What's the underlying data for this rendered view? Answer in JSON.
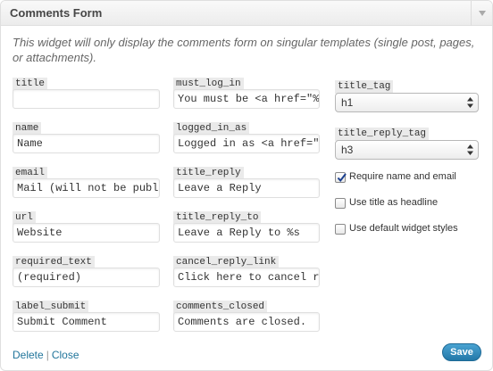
{
  "widget": {
    "title": "Comments Form",
    "description": "This widget will only display the comments form on singular templates (single post, pages, or attachments)."
  },
  "fields_col1": [
    {
      "label": "title",
      "value": ""
    },
    {
      "label": "name",
      "value": "Name"
    },
    {
      "label": "email",
      "value": "Mail (will not be published)"
    },
    {
      "label": "url",
      "value": "Website"
    },
    {
      "label": "required_text",
      "value": "(required)"
    },
    {
      "label": "label_submit",
      "value": "Submit Comment"
    }
  ],
  "fields_col2": [
    {
      "label": "must_log_in",
      "value": "You must be <a href=\"%s\">logged in</a>"
    },
    {
      "label": "logged_in_as",
      "value": "Logged in as <a href=\"%s\">%s</a>"
    },
    {
      "label": "title_reply",
      "value": "Leave a Reply"
    },
    {
      "label": "title_reply_to",
      "value": "Leave a Reply to %s"
    },
    {
      "label": "cancel_reply_link",
      "value": "Click here to cancel reply."
    },
    {
      "label": "comments_closed",
      "value": "Comments are closed."
    }
  ],
  "selects": [
    {
      "label": "title_tag",
      "value": "h1"
    },
    {
      "label": "title_reply_tag",
      "value": "h3"
    }
  ],
  "checkboxes": [
    {
      "label": "Require name and email",
      "checked": true
    },
    {
      "label": "Use title as headline",
      "checked": false
    },
    {
      "label": "Use default widget styles",
      "checked": false
    }
  ],
  "actions": {
    "delete": "Delete",
    "separator": "|",
    "close": "Close",
    "save": "Save"
  },
  "icons": {
    "toggle": "triangle-down-icon",
    "select_arrows": "updown-arrows-icon",
    "checkmark": "checkmark-icon"
  },
  "colors": {
    "link": "#21759b",
    "save_button": "#2378a8"
  }
}
